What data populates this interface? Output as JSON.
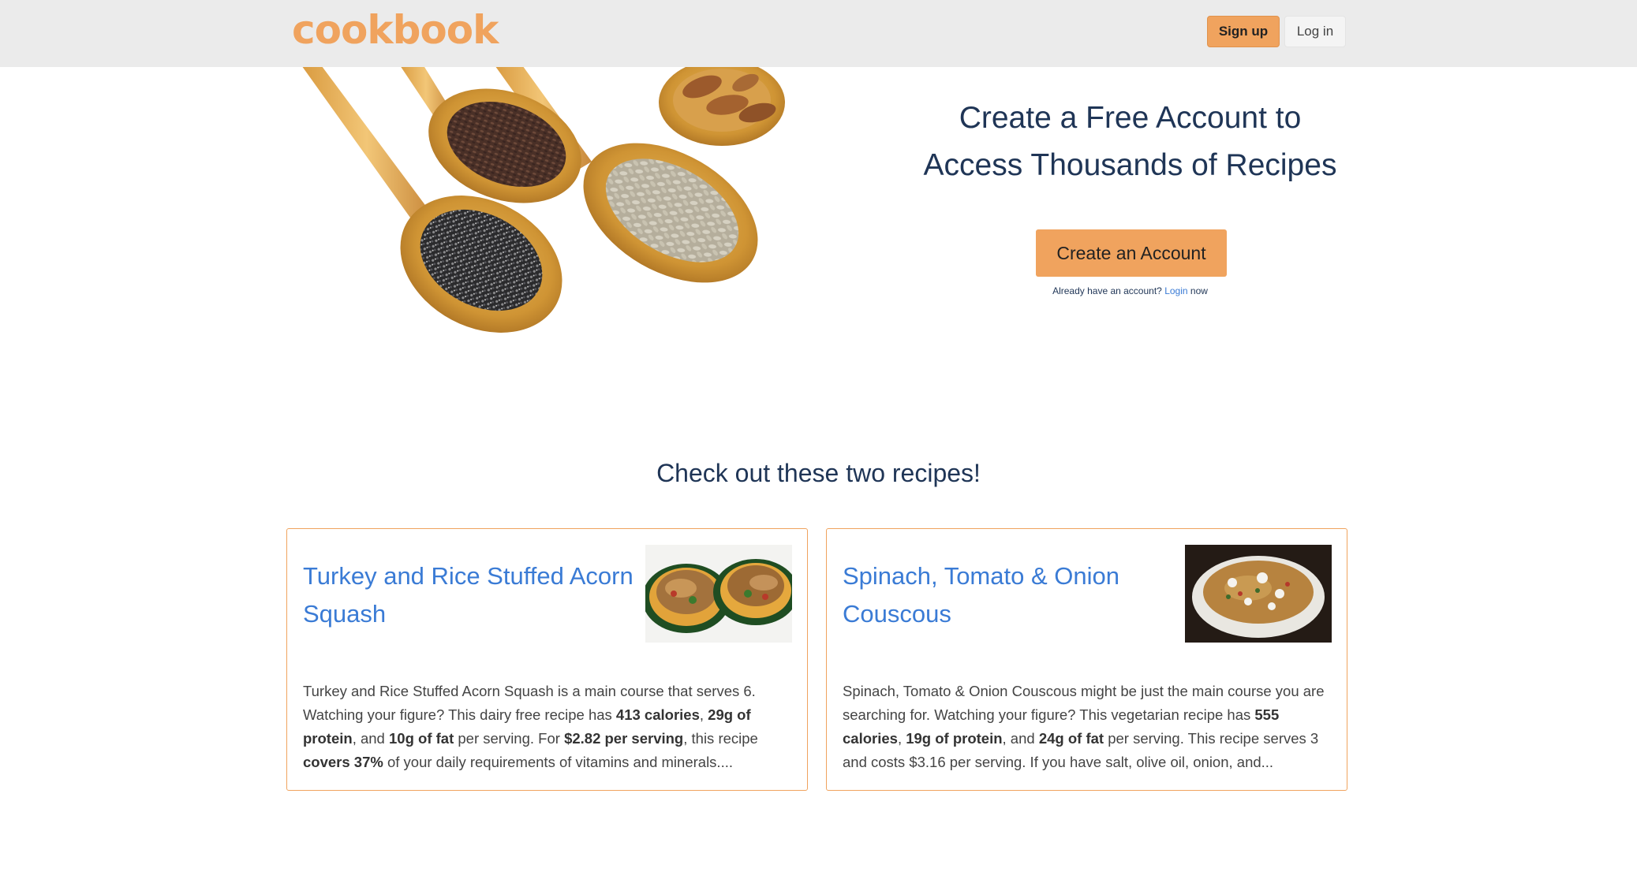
{
  "brand": {
    "logo_text": "cookbook",
    "accent_color": "#f0a35e"
  },
  "nav": {
    "signup_label": "Sign up",
    "login_label": "Log in"
  },
  "hero": {
    "image_icon": "wooden-spoons-with-seeds-image",
    "title_line1": "Create a Free Account to",
    "title_line2": "Access Thousands of Recipes",
    "cta_label": "Create an Account",
    "already_prefix": "Already have an account?",
    "login_link": "Login",
    "already_suffix": "now"
  },
  "recipes": {
    "section_title": "Check out these two recipes!",
    "items": [
      {
        "title": "Turkey and Rice Stuffed Acorn Squash",
        "thumbnail_icon": "stuffed-acorn-squash-photo",
        "desc": [
          "Turkey and Rice Stuffed Acorn Squash is a main course that serves 6. Watching your figure? This dairy free recipe has ",
          "413 calories",
          ", ",
          "29g of protein",
          ", and ",
          "10g of fat",
          " per serving. For ",
          "$2.82 per serving",
          ", this recipe ",
          "covers 37%",
          " of your daily requirements of vitamins and minerals...."
        ]
      },
      {
        "title": "Spinach, Tomato & Onion Couscous",
        "thumbnail_icon": "couscous-bowl-photo",
        "desc": [
          "Spinach, Tomato & Onion Couscous might be just the main course you are searching for. Watching your figure? This vegetarian recipe has ",
          "555 calories",
          ", ",
          "19g of protein",
          ", and ",
          "24g of fat",
          " per serving. This recipe serves 3 and costs $3.16 per serving. If you have salt, olive oil, onion, and..."
        ]
      }
    ]
  }
}
